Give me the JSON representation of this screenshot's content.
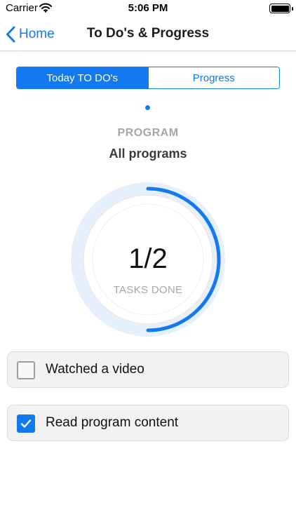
{
  "status_bar": {
    "carrier": "Carrier",
    "time": "5:06 PM",
    "icons": [
      "wifi-icon",
      "battery-icon"
    ]
  },
  "nav": {
    "back_label": "Home",
    "title": "To Do's & Progress"
  },
  "segments": [
    {
      "label": "Today TO DO's",
      "selected": true
    },
    {
      "label": "Progress",
      "selected": false
    }
  ],
  "program": {
    "label": "PROGRAM",
    "value": "All programs"
  },
  "progress": {
    "count_text": "1/2",
    "caption": "TASKS DONE",
    "done": 1,
    "total": 2
  },
  "tasks": [
    {
      "label": "Watched a video",
      "checked": false
    },
    {
      "label": "Read program content",
      "checked": true
    }
  ],
  "colors": {
    "accent": "#1379f0",
    "ring_track": "#e6f0fc",
    "card_bg": "#f2f2f4",
    "muted_text": "#a6a6a8"
  }
}
